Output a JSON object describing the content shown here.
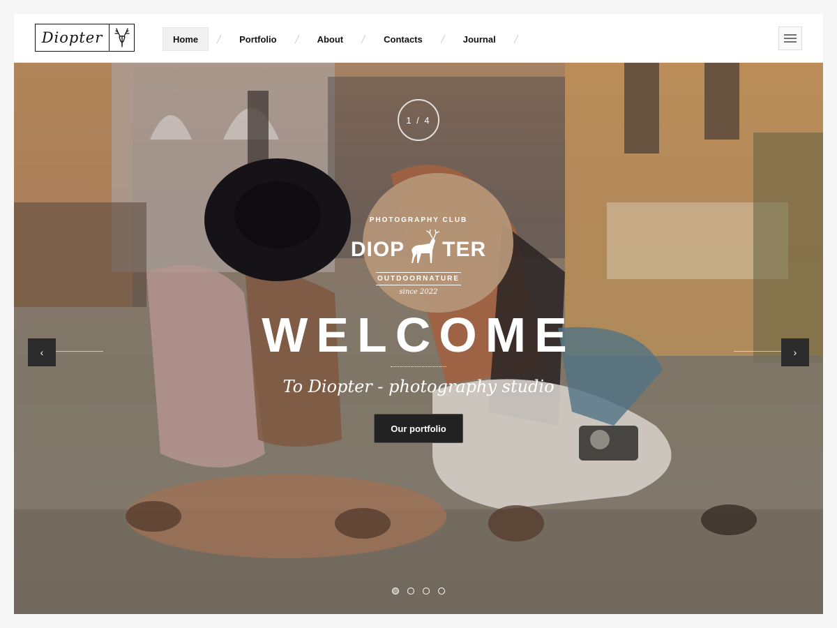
{
  "header": {
    "logo_text": "Diopter",
    "logo_icon": "deer-icon",
    "nav": {
      "home": "Home",
      "portfolio": "Portfolio",
      "about": "About",
      "contacts": "Contacts",
      "journal": "Journal"
    },
    "menu_icon": "hamburger-icon"
  },
  "hero": {
    "counter": "1 / 4",
    "badge": {
      "club": "PHOTOGRAPHY CLUB",
      "brand_left": "DIOP",
      "brand_right": "TER",
      "tagline": "OUTDOORNATURE",
      "since": "since 2022"
    },
    "title": "WELCOME",
    "subtitle": "To Diopter - photography studio",
    "cta_label": "Our portfolio",
    "prev_label": "‹",
    "next_label": "›",
    "slides": 4,
    "active_slide": 1
  },
  "colors": {
    "button_bg": "#222222",
    "arrow_bg": "#2b2b2b",
    "page_bg": "#f6f6f6"
  }
}
